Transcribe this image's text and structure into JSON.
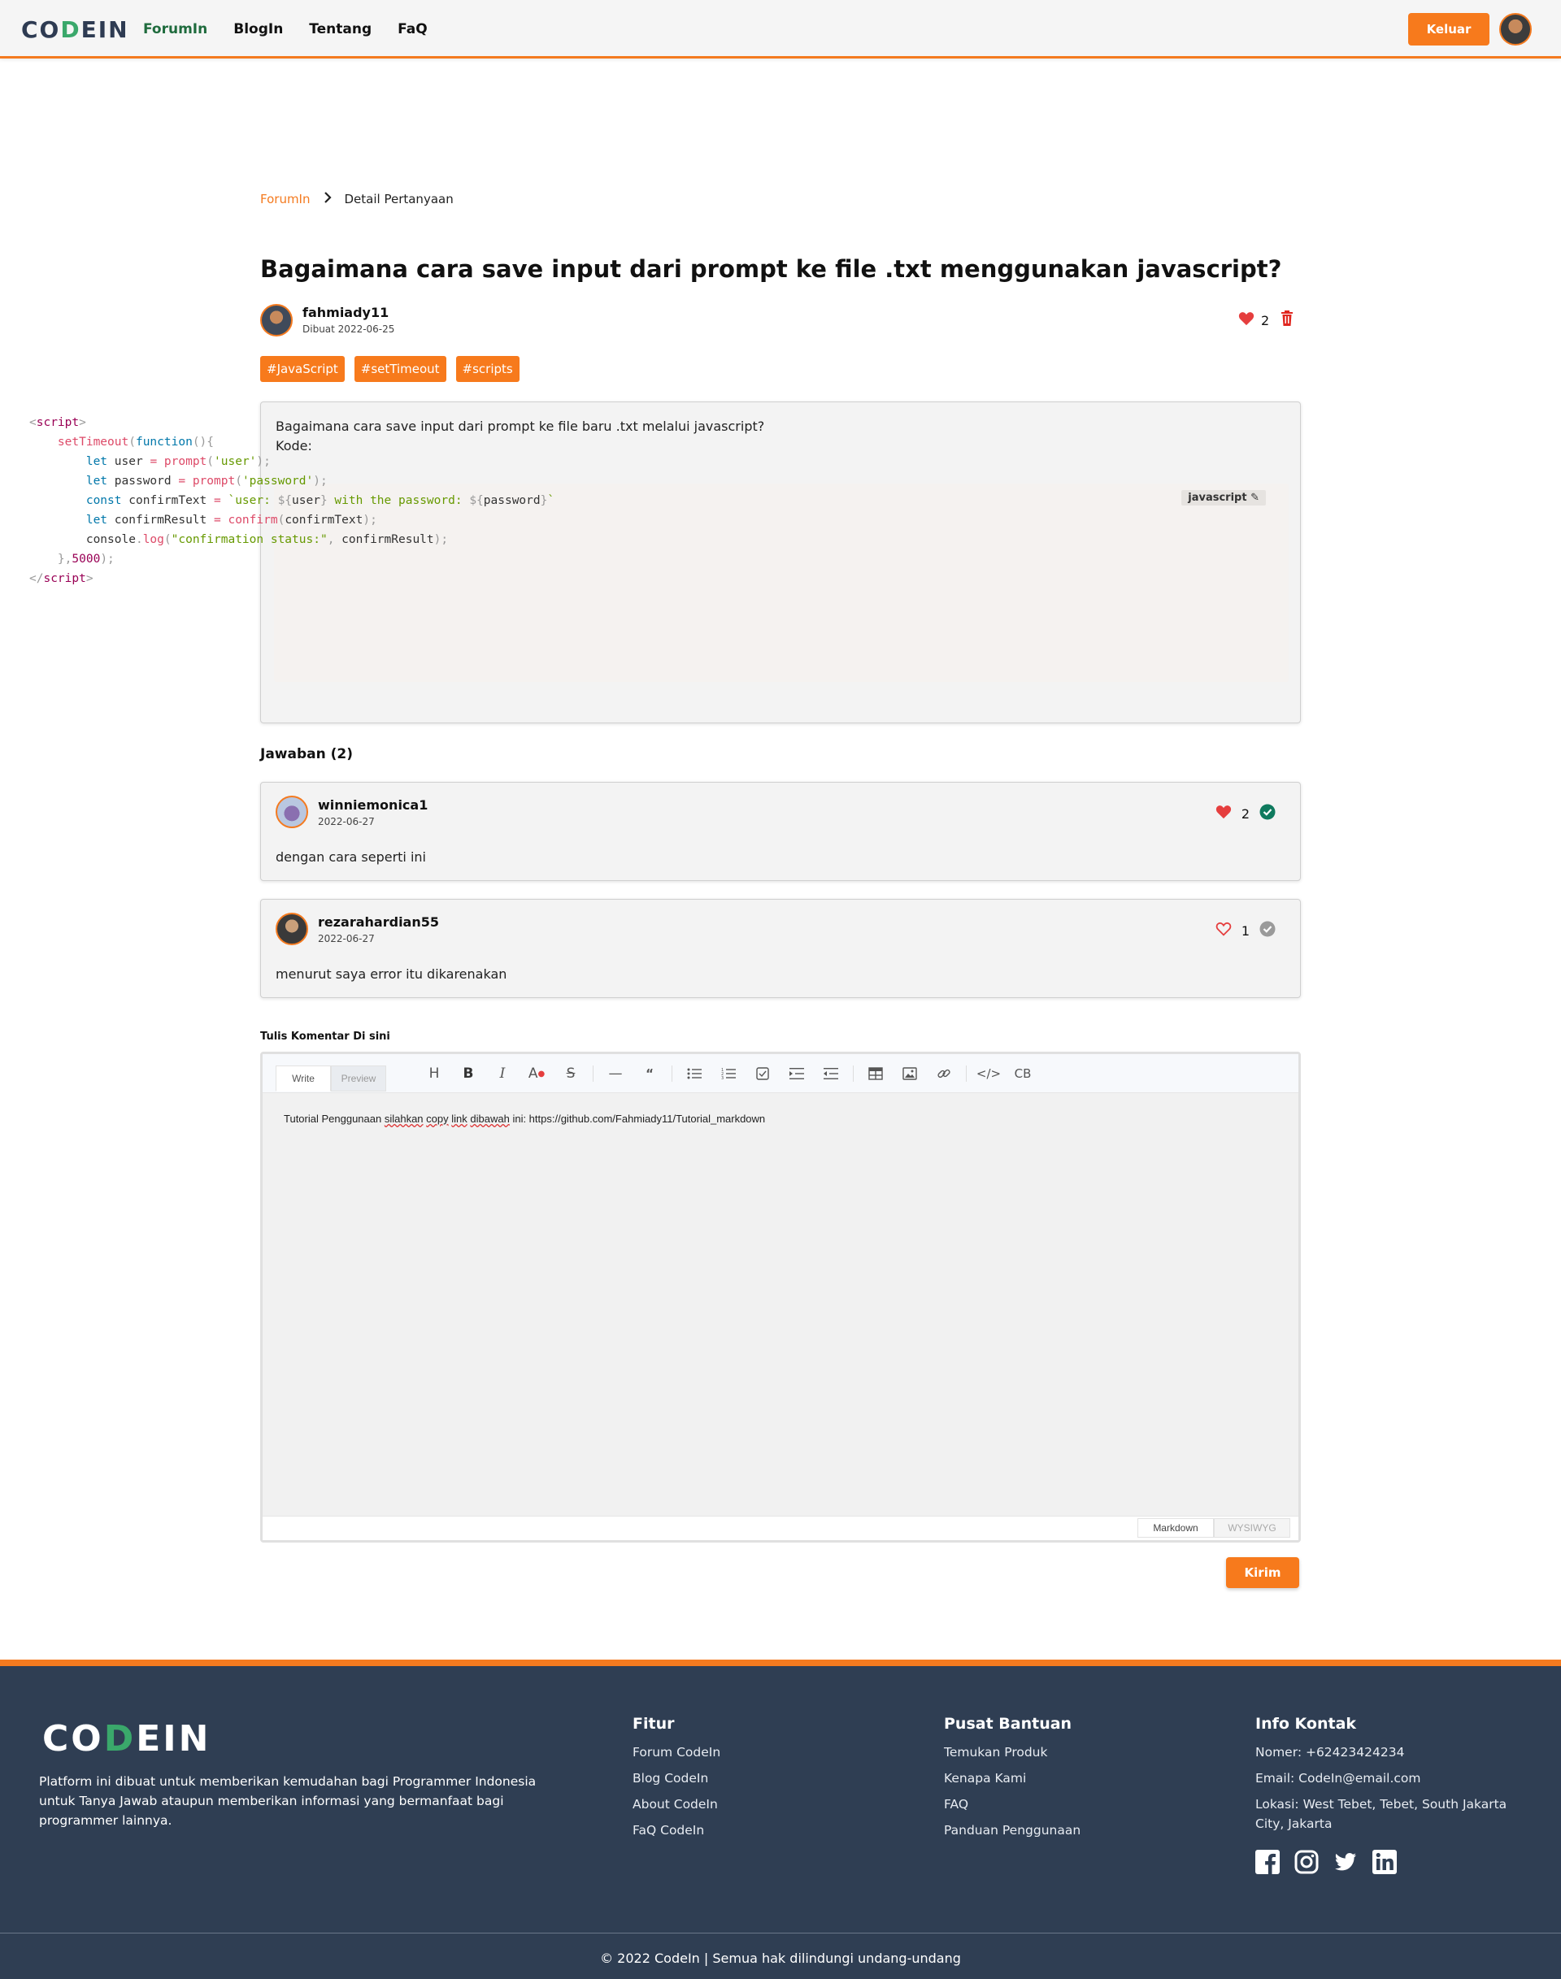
{
  "nav": {
    "logo_prefix": "CO",
    "logo_accent": "D",
    "logo_suffix": "EIN",
    "links": [
      "ForumIn",
      "BlogIn",
      "Tentang",
      "FaQ"
    ],
    "active_link": "ForumIn",
    "logout_label": "Keluar"
  },
  "breadcrumb": {
    "parent": "ForumIn",
    "current": "Detail Pertanyaan"
  },
  "question": {
    "title": "Bagaimana cara save input dari prompt ke file .txt menggunakan javascript?",
    "author": "fahmiady11",
    "date": "Dibuat 2022-06-25",
    "likes": "2",
    "tags": [
      "#JavaScript",
      "#setTimeout",
      "#scripts"
    ],
    "body_line1": "Bagaimana cara save input dari prompt ke file baru .txt melalui javascript?",
    "body_line2": "Kode:",
    "code_language": "javascript"
  },
  "answers": {
    "heading": "Jawaban (2)",
    "items": [
      {
        "author": "winniemonica1",
        "date": "2022-06-27",
        "likes": "2",
        "text": "dengan cara seperti ini",
        "liked": true,
        "accepted": true
      },
      {
        "author": "rezarahardian55",
        "date": "2022-06-27",
        "likes": "1",
        "text": "menurut saya error itu dikarenakan",
        "liked": false,
        "accepted": false
      }
    ]
  },
  "editor": {
    "label": "Tulis Komentar Di sini",
    "tab_write": "Write",
    "tab_preview": "Preview",
    "text_before": "Tutorial Penggunaan ",
    "text_w1": "silahkan",
    "text_w2": "copy",
    "text_w3": "link",
    "text_w4": "dibawah",
    "text_after": " ini:  https://github.com/Fahmiady11/Tutorial_markdown",
    "mode_markdown": "Markdown",
    "mode_wysiwyg": "WYSIWYG",
    "send_label": "Kirim"
  },
  "footer": {
    "logo_prefix": "CO",
    "logo_accent": "D",
    "logo_suffix": "EIN",
    "description": "Platform ini dibuat untuk memberikan kemudahan bagi Programmer Indonesia untuk Tanya Jawab ataupun memberikan informasi yang bermanfaat bagi programmer lainnya.",
    "fitur": {
      "title": "Fitur",
      "items": [
        "Forum CodeIn",
        "Blog CodeIn",
        "About CodeIn",
        "FaQ CodeIn"
      ]
    },
    "bantuan": {
      "title": "Pusat Bantuan",
      "items": [
        "Temukan Produk",
        "Kenapa Kami",
        "FAQ",
        "Panduan Penggunaan"
      ]
    },
    "kontak": {
      "title": "Info Kontak",
      "items": [
        "Nomer: +62423424234",
        "Email: CodeIn@email.com",
        "Lokasi: West Tebet, Tebet, South Jakarta City, Jakarta"
      ]
    },
    "socials": [
      "facebook-icon",
      "instagram-icon",
      "twitter-icon",
      "linkedin-icon"
    ],
    "copyright": "© 2022 CodeIn | Semua hak dilindungi undang-undang"
  },
  "colors": {
    "accent": "#f77a1c",
    "footer_bg": "#2f3e53",
    "nav_active": "#1f6b3d",
    "heart_red": "#e53e3e",
    "check_green": "#0f7a5e"
  }
}
